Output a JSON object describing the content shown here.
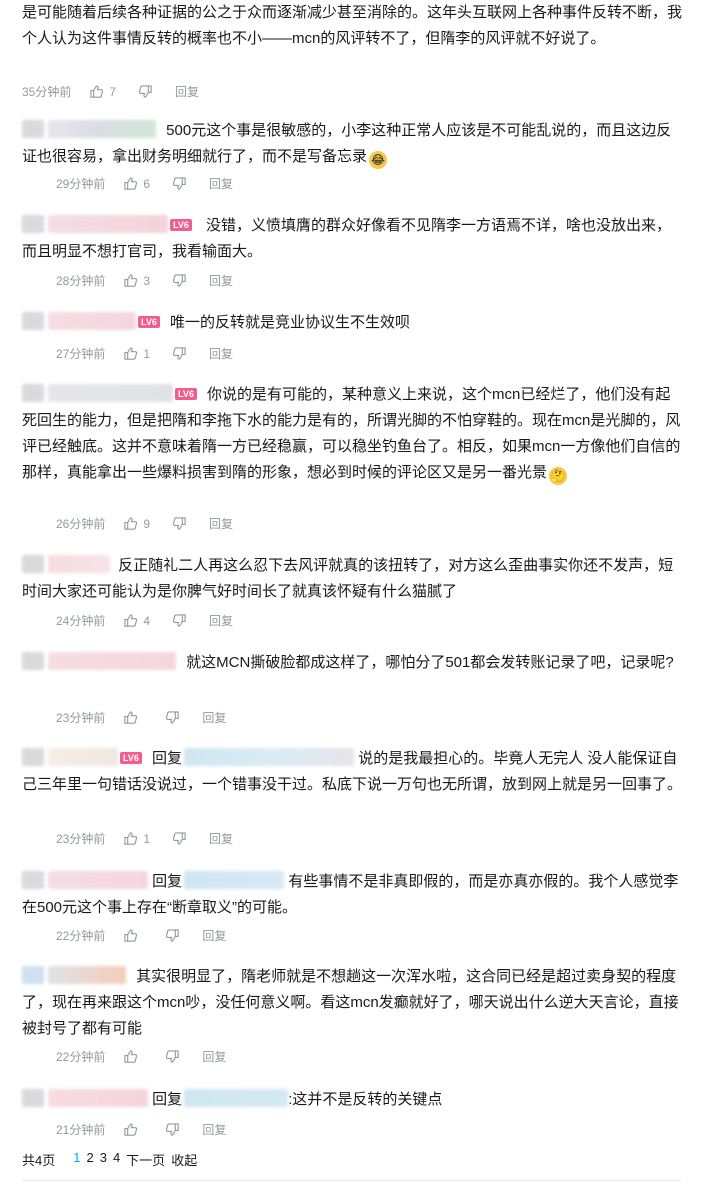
{
  "top_comment": {
    "text": "是可能随着后续各种证据的公之于众而逐渐减少甚至消除的。这年头互联网上各种事件反转不断，我个人认为这件事情反转的概率也不小——mcn的风评转不了，但隋李的风评就不好说了。",
    "time": "35分钟前",
    "likes": "7",
    "reply_label": "回复"
  },
  "replies": [
    {
      "level": "",
      "reply_prefix": "",
      "text": "500元这个事是很敏感的，小李这种正常人应该是不可能乱说的，而且这边反证也很容易，拿出财务明细就行了，而不是写备忘录",
      "emoji": "😂",
      "time": "29分钟前",
      "likes": "6",
      "reply_label": "回复"
    },
    {
      "level": "LV6",
      "reply_prefix": "",
      "text": "没错，义愤填膺的群众好像看不见隋李一方语焉不详，啥也没放出来，而且明显不想打官司，我看输面大。",
      "emoji": "",
      "time": "28分钟前",
      "likes": "3",
      "reply_label": "回复"
    },
    {
      "level": "LV6",
      "reply_prefix": "",
      "text": "唯一的反转就是竞业协议生不生效呗",
      "emoji": "",
      "time": "27分钟前",
      "likes": "1",
      "reply_label": "回复"
    },
    {
      "level": "LV6",
      "reply_prefix": "",
      "text": "你说的是有可能的，某种意义上来说，这个mcn已经烂了，他们没有起死回生的能力，但是把隋和李拖下水的能力是有的，所谓光脚的不怕穿鞋的。现在mcn是光脚的，风评已经触底。这并不意味着隋一方已经稳赢，可以稳坐钓鱼台了。相反，如果mcn一方像他们自信的那样，真能拿出一些爆料损害到隋的形象，想必到时候的评论区又是另一番光景",
      "emoji": "🤔",
      "time": "26分钟前",
      "likes": "9",
      "reply_label": "回复"
    },
    {
      "level": "",
      "reply_prefix": "",
      "text": "反正随礼二人再这么忍下去风评就真的该扭转了，对方这么歪曲事实你还不发声，短时间大家还可能认为是你脾气好时间长了就真该怀疑有什么猫腻了",
      "emoji": "",
      "time": "24分钟前",
      "likes": "4",
      "reply_label": "回复"
    },
    {
      "level": "",
      "reply_prefix": "",
      "text": "就这MCN撕破脸都成这样了，哪怕分了501都会发转账记录了吧，记录呢?",
      "emoji": "",
      "time": "23分钟前",
      "likes": "",
      "reply_label": "回复"
    },
    {
      "level": "LV6",
      "reply_prefix": "回复",
      "text": "说的是我最担心的。毕竟人无完人 没人能保证自己三年里一句错话没说过，一个错事没干过。私底下说一万句也无所谓，放到网上就是另一回事了。",
      "emoji": "",
      "time": "23分钟前",
      "likes": "1",
      "reply_label": "回复"
    },
    {
      "level": "",
      "reply_prefix": "回复",
      "text": "有些事情不是非真即假的，而是亦真亦假的。我个人感觉李在500元这个事上存在“断章取义”的可能。",
      "emoji": "",
      "time": "22分钟前",
      "likes": "",
      "reply_label": "回复"
    },
    {
      "level": "",
      "reply_prefix": "",
      "text": "其实很明显了，隋老师就是不想趟这一次浑水啦，这合同已经是超过卖身契的程度了，现在再来跟这个mcn吵，没任何意义啊。看这mcn发癫就好了，哪天说出什么逆大天言论，直接被封号了都有可能",
      "emoji": "",
      "time": "22分钟前",
      "likes": "",
      "reply_label": "回复"
    },
    {
      "level": "",
      "reply_prefix": "回复",
      "text": ":这并不是反转的关键点",
      "emoji": "",
      "time": "21分钟前",
      "likes": "",
      "reply_label": "回复"
    }
  ],
  "pagination": {
    "total": "共4页",
    "pages": [
      "1",
      "2",
      "3",
      "4"
    ],
    "next": "下一页",
    "collapse": "收起"
  },
  "colors": {
    "accent": "#00aeec",
    "meta": "#9499a0",
    "level_badge": "#f25d8e"
  }
}
